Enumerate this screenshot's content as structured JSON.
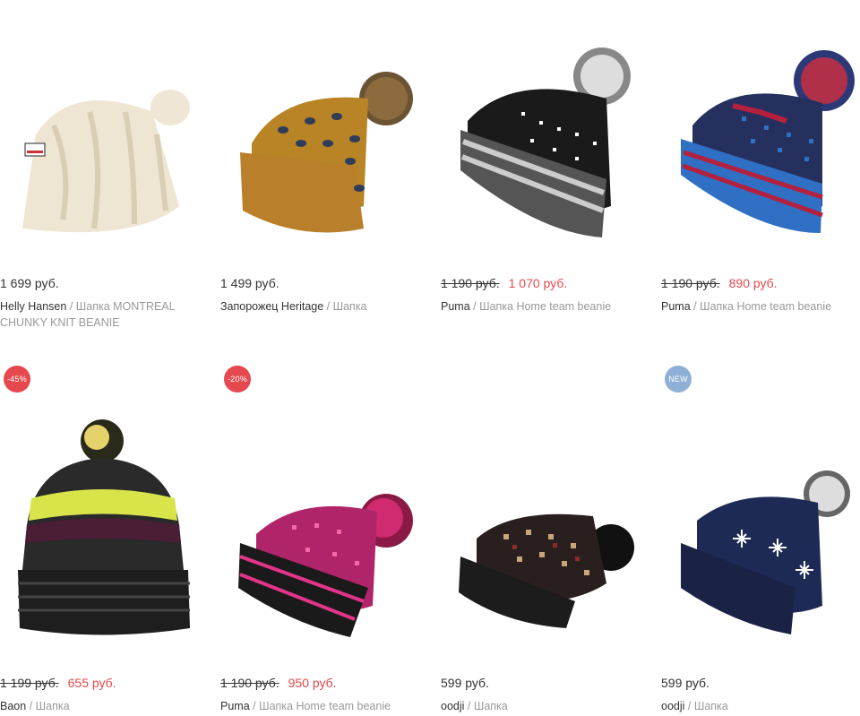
{
  "products": [
    {
      "brand": "Helly Hansen",
      "name": "Шапка MONTREAL CHUNKY KNIT BEANIE",
      "price": "1 699 руб.",
      "old_price": "",
      "new_price": "",
      "badge": ""
    },
    {
      "brand": "Запорожец Heritage",
      "name": "Шапка",
      "price": "1 499 руб.",
      "old_price": "",
      "new_price": "",
      "badge": ""
    },
    {
      "brand": "Puma",
      "name": "Шапка Home team beanie",
      "price": "",
      "old_price": "1 190 руб.",
      "new_price": "1 070 руб.",
      "badge": ""
    },
    {
      "brand": "Puma",
      "name": "Шапка Home team beanie",
      "price": "",
      "old_price": "1 190 руб.",
      "new_price": "890 руб.",
      "badge": ""
    },
    {
      "brand": "Baon",
      "name": "Шапка",
      "price": "",
      "old_price": "1 199 руб.",
      "new_price": "655 руб.",
      "badge": "-45%"
    },
    {
      "brand": "Puma",
      "name": "Шапка Home team beanie",
      "price": "",
      "old_price": "1 190 руб.",
      "new_price": "950 руб.",
      "badge": "-20%"
    },
    {
      "brand": "oodji",
      "name": "Шапка",
      "price": "599 руб.",
      "old_price": "",
      "new_price": "",
      "badge": ""
    },
    {
      "brand": "oodji",
      "name": "Шапка",
      "price": "599 руб.",
      "old_price": "",
      "new_price": "",
      "badge": "NEW"
    }
  ],
  "separator": "/",
  "colors": {
    "sale_price": "#e5484d",
    "discount_badge": "#e5484d",
    "new_badge": "#8fb0d6"
  },
  "icons": [
    "beanie-cream-cable-knit",
    "beanie-mustard-pompom",
    "beanie-black-grey-stripe",
    "beanie-navy-blue-red-stripe",
    "beanie-black-yellow-stripe",
    "beanie-pink-black",
    "beanie-black-nordic",
    "beanie-navy-nordic"
  ]
}
